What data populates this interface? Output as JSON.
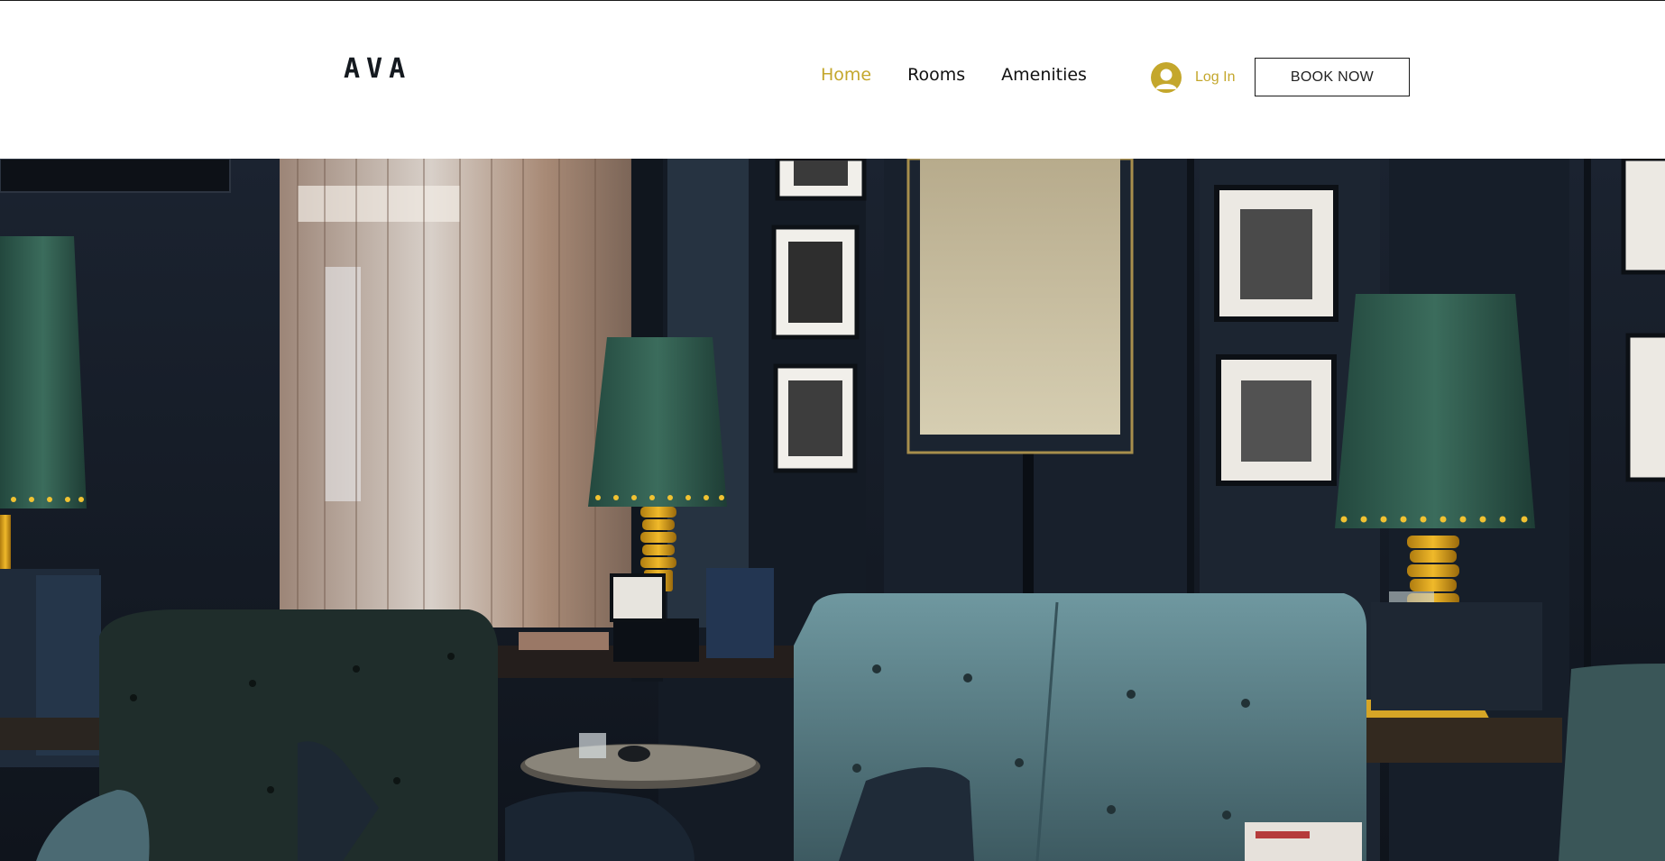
{
  "header": {
    "logo": "AVA",
    "nav": [
      {
        "label": "Home",
        "active": true
      },
      {
        "label": "Rooms",
        "active": false
      },
      {
        "label": "Amenities",
        "active": false
      }
    ],
    "login_label": "Log In",
    "book_label": "BOOK NOW"
  },
  "hero": {
    "icon": "lounge-photo"
  },
  "colors": {
    "accent": "#c4a72c",
    "text": "#111111",
    "hero_bg": "#151c27"
  }
}
